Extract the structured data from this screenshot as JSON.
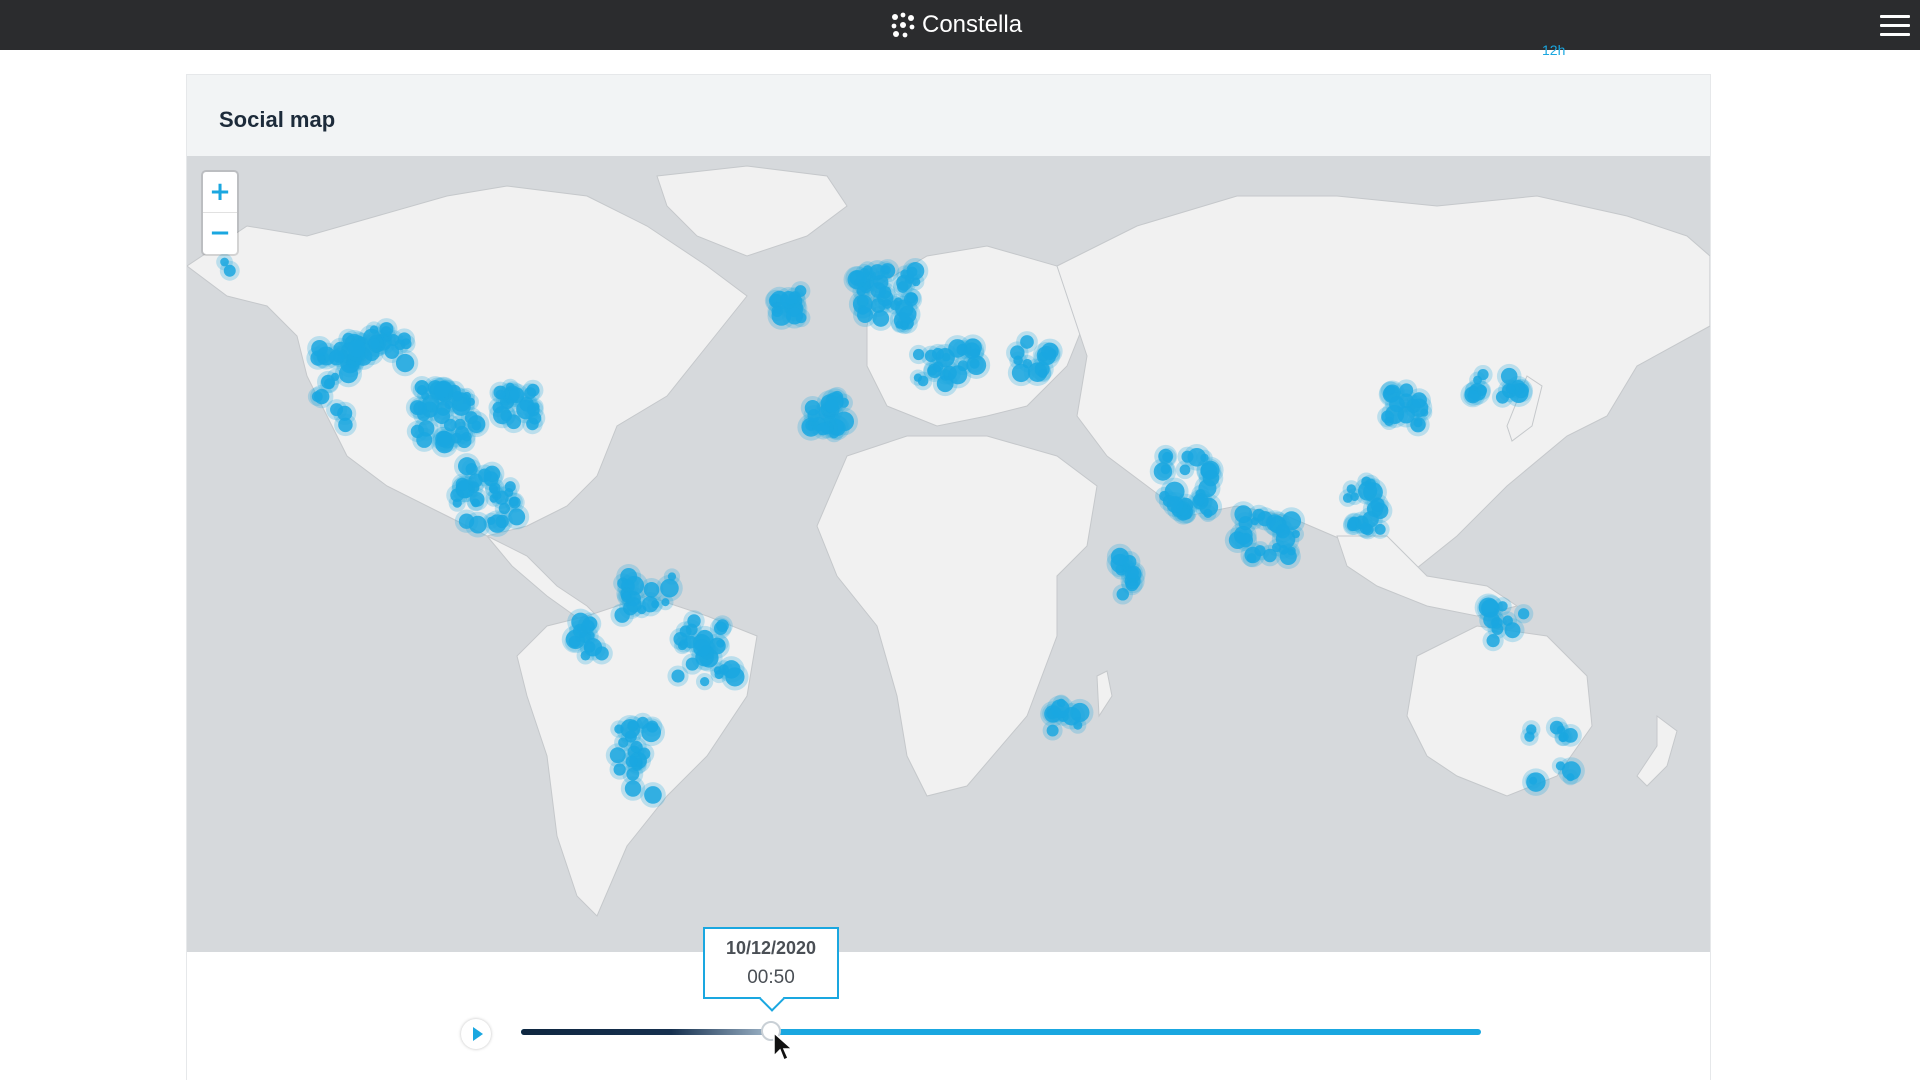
{
  "app": {
    "brand": "Constella",
    "menu_icon": "hamburger-menu-icon",
    "brand_icon": "constellation-dots-icon"
  },
  "header_fragment": "12h",
  "card": {
    "title": "Social map"
  },
  "map": {
    "zoom_in_label": "+",
    "zoom_out_label": "−",
    "colors": {
      "marker": "#1aa7e0",
      "land": "#f1f1f1",
      "ocean": "#d6d9dc",
      "accent": "#1aa7e0"
    }
  },
  "timeline": {
    "date": "10/12/2020",
    "time": "00:50",
    "progress": 0.26,
    "play_icon": "play-icon"
  }
}
